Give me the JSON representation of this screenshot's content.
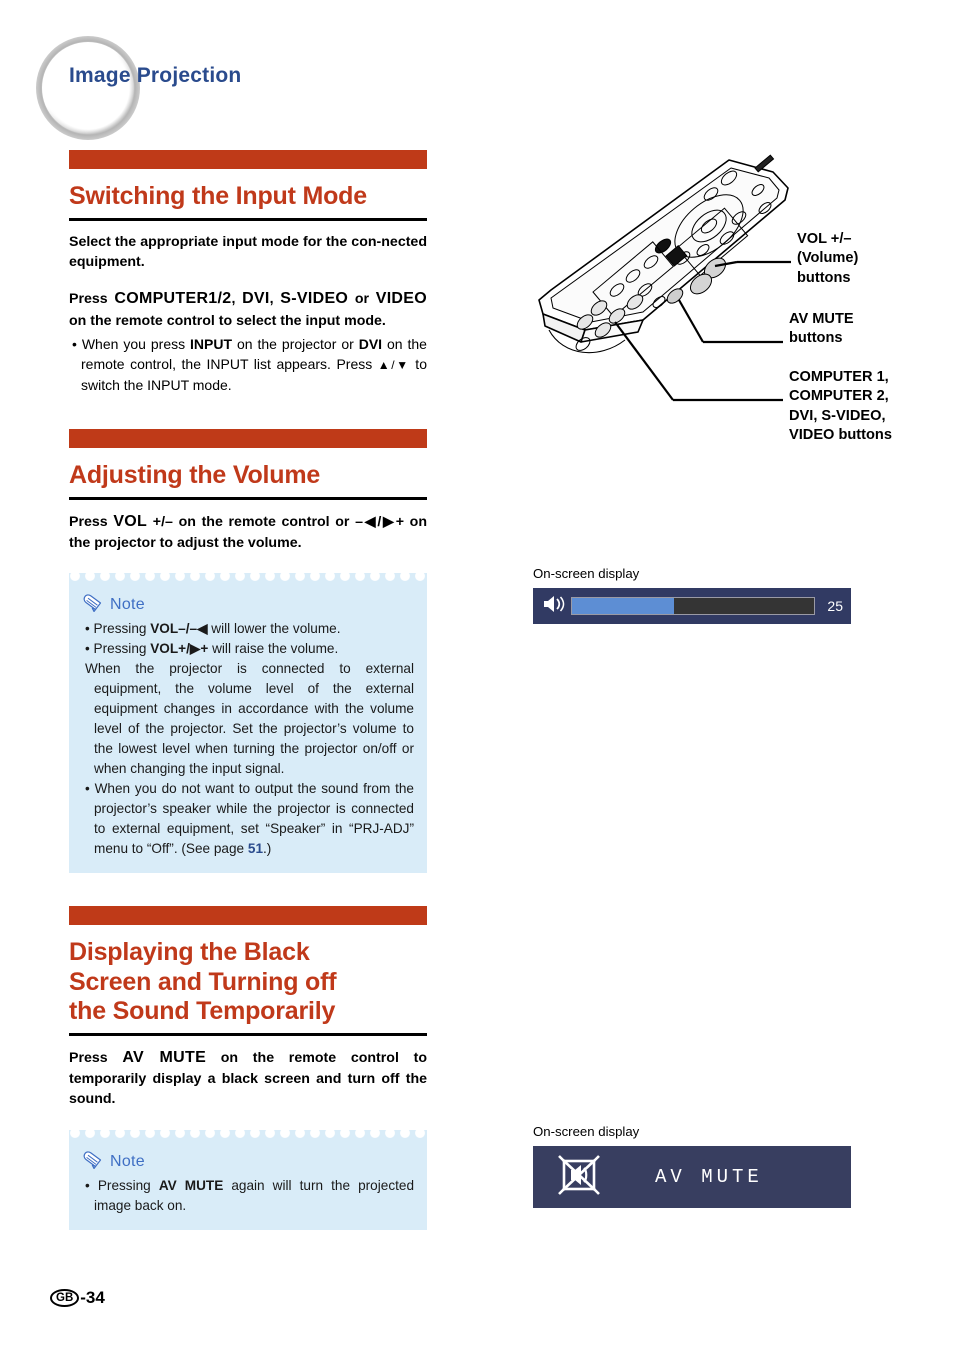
{
  "header": {
    "title": "Image Projection"
  },
  "sections": [
    {
      "title": "Switching the Input Mode",
      "lead_lines": [
        "Select the appropriate input mode for the con-",
        "nected equipment."
      ],
      "instruction": "Press COMPUTER1/2, DVI, S-VIDEO or VIDEO on the remote control to select the input mode.",
      "instruction_parts": {
        "p1": "Press ",
        "b1": "COMPUTER1/2",
        "p2": ", ",
        "b2": "DVI",
        "p3": ", ",
        "b3": "S-VIDEO",
        "p4": " or ",
        "b4": "VIDEO",
        "p5": " on the remote control to select the input mode."
      },
      "bullets": [
        {
          "p1": "When you press ",
          "b1": "INPUT",
          "p2": " on the projector or ",
          "b2": "DVI",
          "p3": " on the remote control, the INPUT list appears. Press ",
          "glyph": "▲/▼",
          "p4": " to switch the INPUT mode."
        }
      ]
    },
    {
      "title": "Adjusting the Volume",
      "instruction_parts": {
        "p1": "Press ",
        "b1": "VOL",
        "p2": " +/– on the remote control or –",
        "g1": "◀",
        "p3": "/",
        "g2": "▶",
        "p4": "+ on the projector to adjust the volume."
      }
    },
    {
      "title_lines": [
        "Displaying the Black",
        "Screen and Turning off",
        "the Sound Temporarily"
      ],
      "instruction_parts": {
        "p1": "Press ",
        "b1": "AV MUTE",
        "p2": " on the remote control to temporarily display a black screen and turn off the sound."
      }
    }
  ],
  "notes": {
    "label": "Note",
    "volume_items": [
      {
        "p1": "Pressing ",
        "b1": "VOL–/–",
        "g1": "◀",
        "p2": " will lower the volume."
      },
      {
        "p1": "Pressing ",
        "b1": "VOL+/",
        "g1": "▶",
        "b2": "+",
        "p2": " will raise the volume."
      },
      {
        "text": "When the projector is connected to external equipment, the volume level of the external equipment changes in accordance with the volume level of the projector. Set the projector’s volume to the lowest level when turning the projector on/off or when changing the input signal."
      },
      {
        "pre": "When you do not want to output the sound from the projector’s speaker while the projector is connected to external equipment, set “Speaker” in  “PRJ-ADJ” menu to “Off”. (See page ",
        "page": "51",
        "post": ".)"
      }
    ],
    "avmute_items": [
      {
        "p1": "Pressing ",
        "b1": "AV MUTE",
        "p2": " again will turn the projected image back on."
      }
    ]
  },
  "remote_callouts": [
    {
      "lines": [
        "VOL +/–",
        "(Volume)",
        "buttons"
      ]
    },
    {
      "lines": [
        "AV MUTE",
        "buttons"
      ]
    },
    {
      "lines": [
        "COMPUTER 1,",
        "COMPUTER 2,",
        "DVI, S-VIDEO,",
        "VIDEO buttons"
      ]
    }
  ],
  "osd": {
    "volume": {
      "caption": "On-screen display",
      "value": "25",
      "fill_percent": 42,
      "icon": "speaker-icon",
      "bg_color": "#313a63",
      "fill_color": "#5d8ed4",
      "track_color": "#343434"
    },
    "avmute": {
      "caption": "On-screen display",
      "label": "AV MUTE",
      "icon": "av-mute-icon",
      "bg_color": "#383e60"
    }
  },
  "footer": {
    "region": "GB",
    "page": "-34"
  },
  "colors": {
    "accent_orange": "#bf3a18",
    "heading_blue": "#2a4b8d",
    "note_bg": "#d9ecf8",
    "note_label": "#3f6fc4"
  }
}
